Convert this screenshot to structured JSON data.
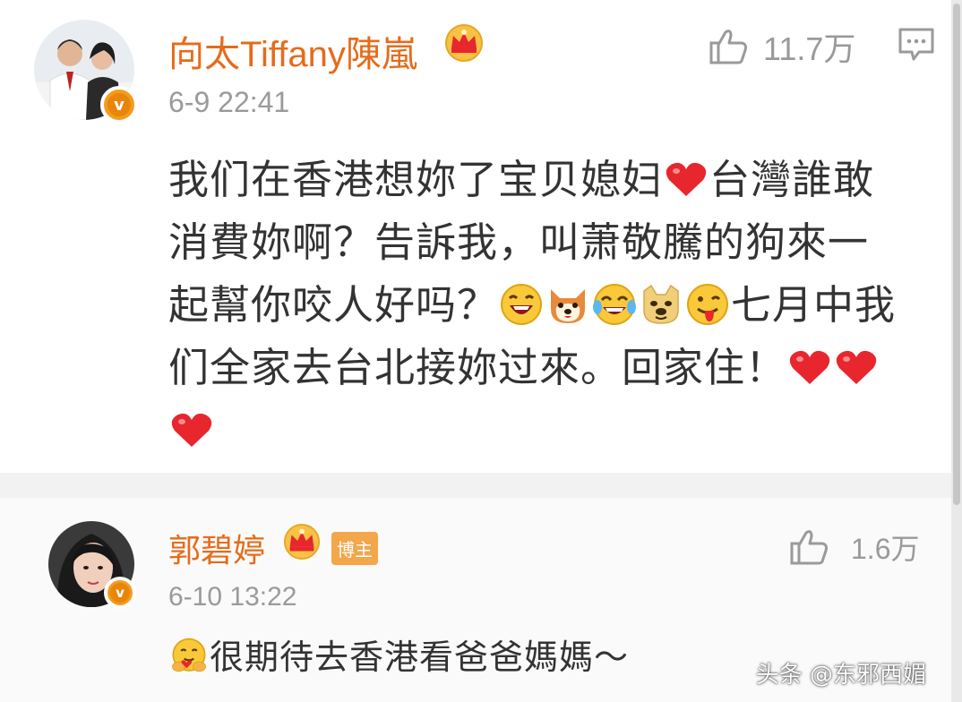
{
  "comments": [
    {
      "username": "向太Tiffany陳嵐",
      "timestamp": "6-9 22:41",
      "likes": "11.7万",
      "lines": [
        [
          "我们在香港想妳了宝贝媳妇",
          "台灣誰敢"
        ],
        [
          "消費妳啊？告訴我，叫萧敬騰的狗來一"
        ],
        [
          "起幫你咬人好吗？",
          "七月中我"
        ],
        [
          "们全家去台北接妳过來。回家住！"
        ]
      ],
      "emojis": [
        "heart",
        "laughing-face",
        "shiba-dog",
        "crying-laughing-face",
        "doge",
        "tongue-face",
        "heart",
        "heart",
        "heart"
      ]
    },
    {
      "username": "郭碧婷",
      "badge": "博主",
      "timestamp": "6-10 13:22",
      "likes": "1.6万",
      "text": "很期待去香港看爸爸媽媽～",
      "emojis": [
        "hugging-face"
      ]
    }
  ],
  "watermark": "头条 @东邪西媚",
  "colors": {
    "username": "#e66b1a",
    "timestamp": "#9a9a9a",
    "body": "#333333",
    "heart": "#e8262d",
    "vbadge": "#f59b1c",
    "badge": "#f3a64a"
  }
}
